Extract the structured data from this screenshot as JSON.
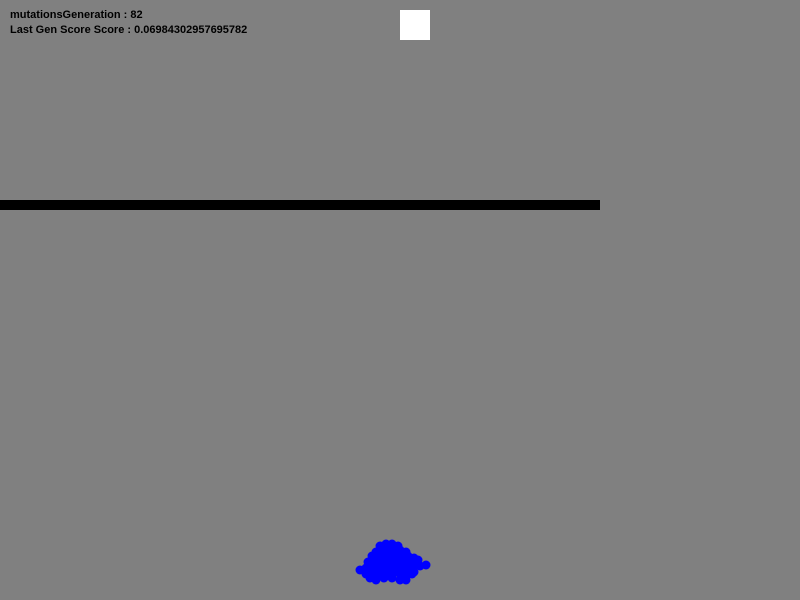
{
  "hud": {
    "generation_text": "mutationsGeneration : 82",
    "score_text": "Last Gen Score Score : 0.06984302957695782"
  },
  "colors": {
    "background": "#808080",
    "target": "#ffffff",
    "obstacle": "#000000",
    "rocket": "#0000ff",
    "hud_text": "#000000"
  },
  "icons": {
    "target": "target-square",
    "obstacle": "obstacle-bar",
    "population": "rocket-swarm"
  }
}
